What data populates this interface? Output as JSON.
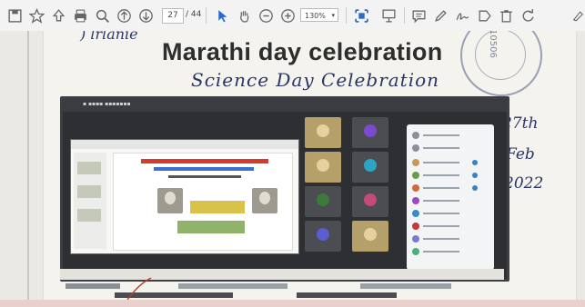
{
  "toolbar": {
    "page_current": "27",
    "page_total": "/ 44",
    "zoom": "130%",
    "icons": [
      "save-icon",
      "bookmark-star-icon",
      "upload-icon",
      "print-icon",
      "zoom-search-icon",
      "page-up-icon",
      "page-down-icon",
      "select-arrow-icon",
      "hand-pan-icon",
      "zoom-out-icon",
      "zoom-in-icon",
      "fit-page-icon",
      "presentation-icon",
      "comment-icon",
      "highlight-pen-icon",
      "sign-icon",
      "stamp-icon",
      "delete-icon",
      "rotate-icon"
    ]
  },
  "document": {
    "title": "Marathi day celebration",
    "subtitle": "Science Day Celebration",
    "handwritten_date": [
      "27th",
      "Feb",
      "2022"
    ],
    "stamp_number": "10506"
  },
  "colors": {
    "toolbar_bg": "#f3f3f3",
    "select_arrow": "#2a6ad0",
    "paper": "#f4f3ee",
    "ink": "#2b3563"
  }
}
